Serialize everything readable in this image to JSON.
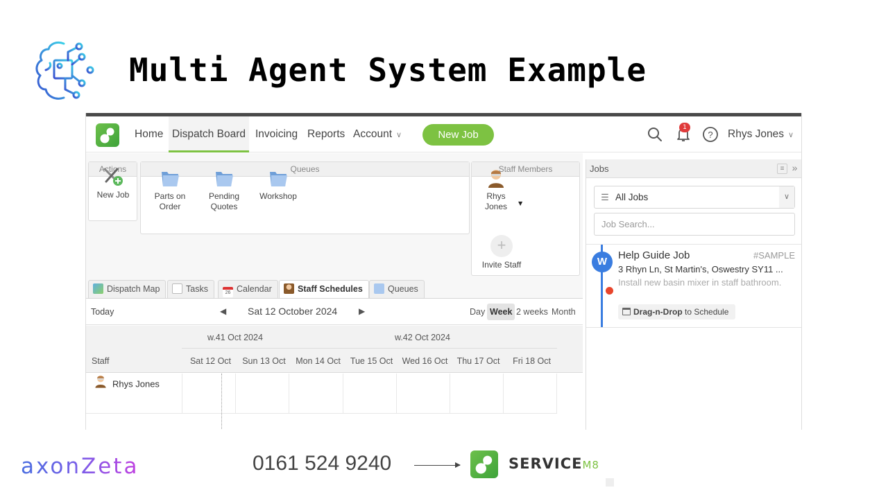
{
  "slide": {
    "title": "Multi Agent System Example",
    "footer": {
      "brand": "axonZeta",
      "phone": "0161 524 9240",
      "partner_wordmark": "SERVICE",
      "partner_wordmark_suffix": "M8"
    }
  },
  "nav": {
    "items": [
      {
        "label": "Home"
      },
      {
        "label": "Dispatch Board",
        "active": true
      },
      {
        "label": "Invoicing"
      },
      {
        "label": "Reports"
      },
      {
        "label": "Account"
      }
    ],
    "new_job_label": "New Job",
    "notification_count": "1",
    "user_name": "Rhys Jones",
    "icons": [
      "search-icon",
      "bell-icon",
      "help-icon"
    ]
  },
  "actions": {
    "header": "Actions",
    "items": [
      {
        "label": "New Job",
        "icon": "tools-add-icon"
      }
    ]
  },
  "queues": {
    "header": "Queues",
    "items": [
      {
        "label_line1": "Parts on",
        "label_line2": "Order",
        "icon": "folder-icon"
      },
      {
        "label_line1": "Pending",
        "label_line2": "Quotes",
        "icon": "folder-icon"
      },
      {
        "label_line1": "Workshop",
        "label_line2": "",
        "icon": "folder-icon"
      }
    ]
  },
  "staff_members": {
    "header": "Staff Members",
    "members": [
      {
        "first": "Rhys",
        "last": "Jones"
      }
    ],
    "invite_label": "Invite Staff"
  },
  "tabs": [
    {
      "label": "Dispatch Map",
      "icon": "map-icon"
    },
    {
      "label": "Tasks",
      "icon": "tasks-icon"
    },
    {
      "label": "Calendar",
      "icon": "calendar-icon"
    },
    {
      "label": "Staff Schedules",
      "icon": "staff-icon",
      "active": true
    },
    {
      "label": "Queues",
      "icon": "folder-icon"
    }
  ],
  "schedule": {
    "today_label": "Today",
    "current_date": "Sat 12 October 2024",
    "views": [
      {
        "label": "Day"
      },
      {
        "label": "Week",
        "active": true
      },
      {
        "label": "2 weeks"
      },
      {
        "label": "Month"
      }
    ],
    "weeks": [
      "w.41 Oct 2024",
      "w.42 Oct 2024"
    ],
    "staff_header": "Staff",
    "days": [
      "Sat 12 Oct",
      "Sun 13 Oct",
      "Mon 14 Oct",
      "Tue 15 Oct",
      "Wed 16 Oct",
      "Thu 17 Oct",
      "Fri 18 Oct"
    ],
    "rows": [
      {
        "staff": "Rhys Jones"
      }
    ]
  },
  "jobs_panel": {
    "header": "Jobs",
    "filter_value": "All Jobs",
    "search_placeholder": "Job Search...",
    "jobs": [
      {
        "avatar_letter": "W",
        "title": "Help Guide Job",
        "id": "#SAMPLE",
        "address": "3 Rhyn Ln, St Martin's, Oswestry SY11 ...",
        "description": "Install new basin mixer in staff bathroom.",
        "action_bold": "Drag-n-Drop",
        "action_rest": " to Schedule",
        "status_color": "#e8452c",
        "rail_color": "#3a7de0"
      }
    ]
  },
  "colors": {
    "brand_green": "#7dc242",
    "accent_blue": "#3a7de0",
    "badge_red": "#e03b3b"
  }
}
